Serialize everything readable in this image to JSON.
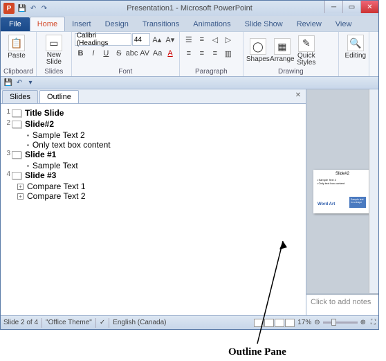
{
  "window": {
    "title": "Presentation1 - Microsoft PowerPoint",
    "app_initial": "P"
  },
  "tabs": {
    "file": "File",
    "items": [
      "Home",
      "Insert",
      "Design",
      "Transitions",
      "Animations",
      "Slide Show",
      "Review",
      "View"
    ],
    "active": "Home"
  },
  "ribbon": {
    "clipboard": {
      "label": "Clipboard",
      "paste": "Paste"
    },
    "slides": {
      "label": "Slides",
      "new_slide": "New\nSlide"
    },
    "font": {
      "label": "Font",
      "name": "Calibri (Headings",
      "size": "44"
    },
    "paragraph": {
      "label": "Paragraph"
    },
    "drawing": {
      "label": "Drawing",
      "shapes": "Shapes",
      "arrange": "Arrange",
      "quick_styles": "Quick\nStyles"
    },
    "editing": {
      "label": "Editing"
    }
  },
  "pane_tabs": {
    "slides": "Slides",
    "outline": "Outline"
  },
  "outline": {
    "slides": [
      {
        "num": "1",
        "title": "Title Slide",
        "bullets": [],
        "expandable": []
      },
      {
        "num": "2",
        "title": "Slide#2",
        "bullets": [
          "Sample Text 2",
          "Only text box content"
        ],
        "expandable": []
      },
      {
        "num": "3",
        "title": "Slide #1",
        "bullets": [
          "Sample Text"
        ],
        "expandable": []
      },
      {
        "num": "4",
        "title": "Slide #3",
        "bullets": [],
        "expandable": [
          "Compare Text 1",
          "Compare Text 2"
        ]
      }
    ]
  },
  "slide_preview": {
    "title": "Slide#2",
    "bullets": [
      "Sample Text 2",
      "Only text box content"
    ],
    "wordart": "Word Art",
    "shape_text": "Sample text in a shape"
  },
  "notes": {
    "placeholder": "Click to add notes"
  },
  "status": {
    "slide_info": "Slide 2 of 4",
    "theme": "\"Office Theme\"",
    "language": "English (Canada)",
    "zoom": "17%"
  },
  "annotation": "Outline Pane"
}
